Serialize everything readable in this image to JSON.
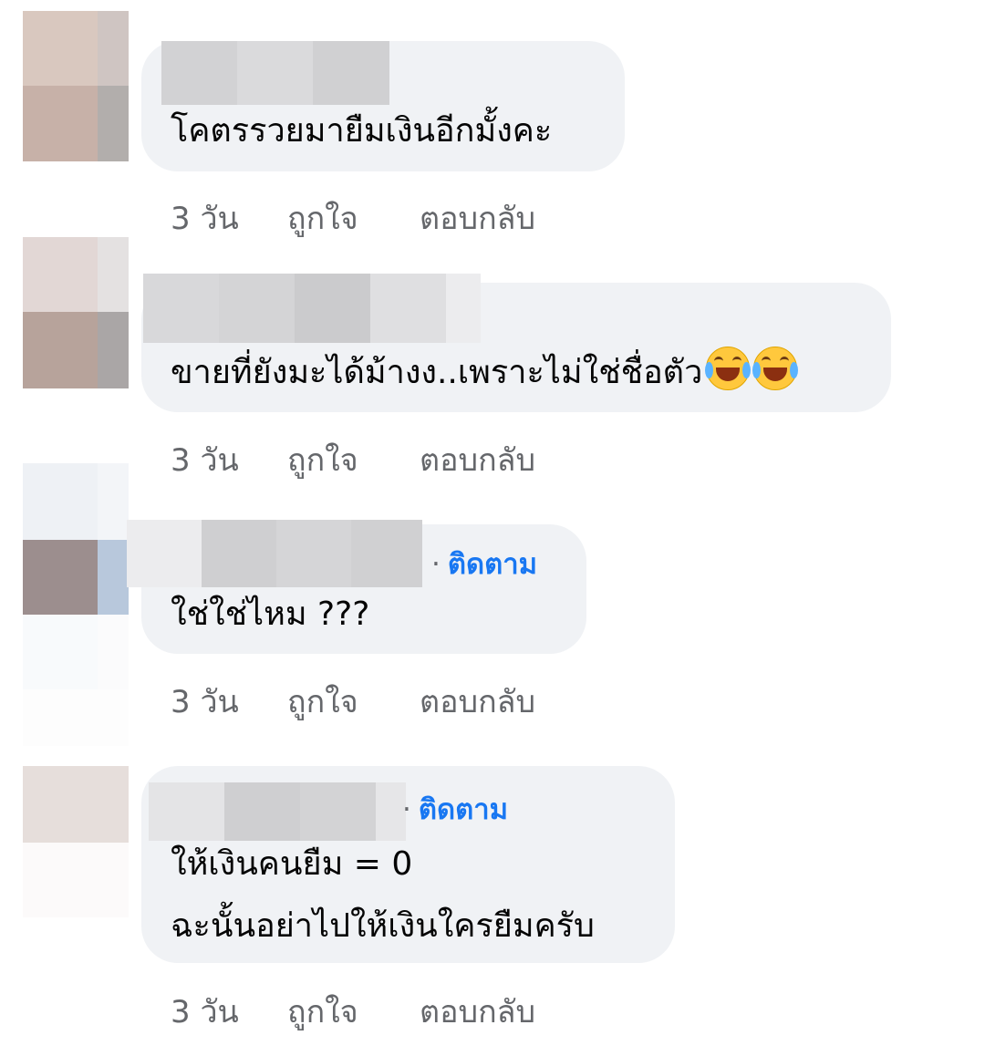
{
  "comments": [
    {
      "text_lines": [
        "โคตรรวยมายืมเงินอีกมั้งคะ"
      ],
      "follow": null,
      "actions": {
        "time": "3 วัน",
        "like": "ถูกใจ",
        "reply": "ตอบกลับ"
      }
    },
    {
      "text_lines": [
        "ขายที่ยังมะได้ม้างง..เพราะไม่ใช่ชื่อตัว"
      ],
      "emoji": [
        "face-with-tears-of-joy",
        "face-with-tears-of-joy"
      ],
      "follow": null,
      "actions": {
        "time": "3 วัน",
        "like": "ถูกใจ",
        "reply": "ตอบกลับ"
      }
    },
    {
      "text_lines": [
        "ใช่ใช่ไหม ???"
      ],
      "follow": "ติดตาม",
      "actions": {
        "time": "3 วัน",
        "like": "ถูกใจ",
        "reply": "ตอบกลับ"
      }
    },
    {
      "text_lines": [
        "ให้เงินคนยืม = 0",
        "ฉะนั้นอย่าไปให้เงินใครยืมครับ"
      ],
      "follow": "ติดตาม",
      "actions": {
        "time": "3 วัน",
        "like": "ถูกใจ",
        "reply": "ตอบกลับ"
      }
    }
  ],
  "colors": {
    "bubble": "#f0f2f5",
    "follow_link": "#1877f2",
    "meta_text": "#65676b"
  }
}
